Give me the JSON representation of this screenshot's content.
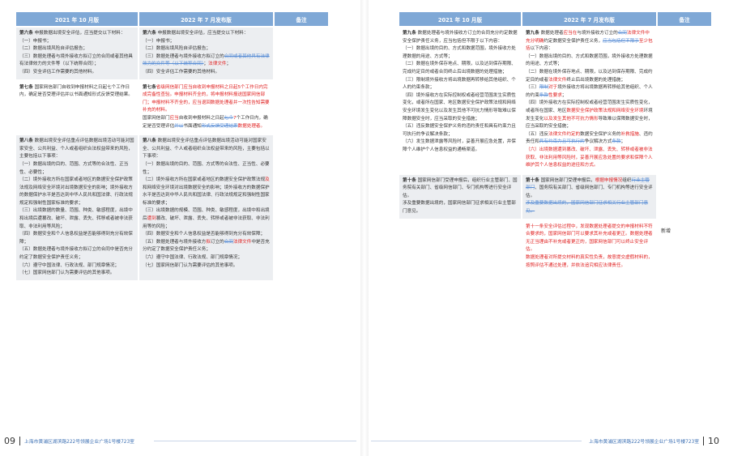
{
  "header": {
    "col1": "2021 年 10 月版",
    "col2": "2022 年 7 月发布版",
    "col3": "备注"
  },
  "left": {
    "rows": [
      {
        "c1": [
          {
            "t": "第六条",
            "s": "b"
          },
          {
            "t": " 申报数据出境安全评估，应当提交以下材料：\n（一）申报书；\n（二）数据出境风险自评估报告；\n（三）数据处理者与境外接收方拟订立的合同或者其他具有法律效力的文件等（以下统称合同）；\n（四）安全评估工作需要的其他材料。"
          }
        ],
        "c2": [
          {
            "t": "第六条",
            "s": "b"
          },
          {
            "t": " 申报数据出境安全评估，应当提交以下材料：\n（一）申报书；\n（二）数据出境风险自评估报告；\n（三）数据处理者与境外接收方拟订立的"
          },
          {
            "t": "合同或者其他具有法律效力的文件等（以下统称合同）",
            "s": "del"
          },
          {
            "t": "；"
          },
          {
            "t": "法律文件",
            "s": "red"
          },
          {
            "t": "；\n（四）安全评估工作需要的其他材料。"
          }
        ],
        "c3": "",
        "white": false
      },
      {
        "c1": [
          {
            "t": "第七条",
            "s": "b"
          },
          {
            "t": " 国家网信部门自收到申报材料之日起七个工作日内，确定是否受理评估并以书面通知形式反馈受理结果。"
          }
        ],
        "c2": [
          {
            "t": "第七条",
            "s": "b"
          },
          {
            "t": "省级网信部门应当自收到申报材料之日起5个工作日内完成完备性查验。申报材料齐全的，将申报材料报送国家网信部门；申报材料不齐全的，应当退回数据处理者并一次性告知需要补充的材料。",
            "s": "red"
          },
          {
            "t": "\n国家网信部门"
          },
          {
            "t": "应当",
            "s": "red"
          },
          {
            "t": "自收到申报材料之日起"
          },
          {
            "t": "七个",
            "s": "del"
          },
          {
            "t": "7",
            "s": "red"
          },
          {
            "t": "个工作日内，确定是否受理评估"
          },
          {
            "t": "并以",
            "s": "del"
          },
          {
            "t": "书面通知"
          },
          {
            "t": "形式反馈受理结果",
            "s": "del"
          },
          {
            "t": "数据处理者。",
            "s": "red"
          }
        ],
        "c3": "",
        "white": true
      },
      {
        "c1": [
          {
            "t": "第八条",
            "s": "b"
          },
          {
            "t": " 数据出境安全评估重点评估数据出境活动可能对国家安全、公共利益、个人或者组织合法权益带来的风险，主要包括以下事项：\n（一）数据出境的目的、范围、方式等的合法性、正当性、必要性；\n（二）境外接收方所在国家或者地区的数据安全保护政策法规及网络安全环境对出境数据安全的影响；境外接收方的数据保护水平是否达到中华人民共和国法律、行政法规规定和强制性国家标准的要求；\n（三）出境数据的数量、范围、种类、敏感程度，出境中和出境后遭篡改、破坏、泄露、丢失、转移或者被非法获取、非法利用等风险；\n（四）数据安全和个人信息权益是否能够得到充分有效保障；\n（五）数据处理者与境外接收方拟订立的合同中是否充分约定了数据安全保护责任义务；\n（六）遵守中国法律、行政法规、部门规章情况；\n（七）国家网信部门认为需要评估的其他事项。"
          }
        ],
        "c2": [
          {
            "t": "第八条",
            "s": "b"
          },
          {
            "t": " 数据出境安全评估重点评估数据出境活动可能对国家安全、公共利益、个人或者组织合法权益带来的风险，主要包括以下事项：\n（一）数据出境的目的、范围、方式等的合法性、正当性、必要性；\n（二）境外接收方所在国家或者地区的数据安全保护政策法规"
          },
          {
            "t": "及",
            "s": "red"
          },
          {
            "t": "和网络安全环境对出境数据安全的影响；境外接收方的数据保护水平是否达到中华人民共和国法律、行政法规规定和强制性国家标准的要求；\n（三）出境数据的规模、范围、种类、敏感程度，出境中和出境后"
          },
          {
            "t": "遭到",
            "s": "red"
          },
          {
            "t": "篡改、破坏、泄露、丢失、转移或者被非法获取、非法利用等的风险；\n（四）数据安全和个人信息权益是否能够得到充分有效保障；\n（五）数据处理者与境外接收方"
          },
          {
            "t": "拟",
            "s": "red"
          },
          {
            "t": "订立的"
          },
          {
            "t": "合同",
            "s": "del"
          },
          {
            "t": "法律文件",
            "s": "red"
          },
          {
            "t": "中是否充分约定了数据安全保护责任义务；\n（六）遵守中国法律、行政法规、部门规章情况；\n（七）国家网信部门认为需要评估的其他事项。"
          }
        ],
        "c3": "",
        "white": false
      }
    ]
  },
  "right": {
    "rows": [
      {
        "c1": [
          {
            "t": "第九条",
            "s": "b"
          },
          {
            "t": " 数据处理者与境外接收方订立的合同充分约定数据安全保护责任义务，应当包括但不限于以下内容：\n（一）数据出境的目的、方式和数据范围，境外接收方处理数据的用途、方式等；\n（二）数据在境外保存地点、期限，以及达到保存期限、完成约定目的或者合同终止后出境数据的处理措施；\n（三）限制境外接收方将出境数据再转移给其他组织、个人的约束条款；\n（四）境外接收方在实际控制权或者经营范围发生实质性变化，或者所在国家、地区数据安全保护政策法规和网络安全环境发生变化以及发生其他不可抗力情形导致难以保障数据安全时，应当采取的安全措施；\n（五）违反数据安全保护义务的违约责任和具有约束力且可执行的争议解决条款；\n（六）发生数据泄露等风险时，妥善开展应急处置，并保障个人维护个人信息权益的通畅渠道。"
          }
        ],
        "c2": [
          {
            "t": "第九条",
            "s": "b"
          },
          {
            "t": " 数据处理者"
          },
          {
            "t": "应当在",
            "s": "red"
          },
          {
            "t": "与境外接收方订立的"
          },
          {
            "t": "合同",
            "s": "del"
          },
          {
            "t": "法律文件中充分明确",
            "s": "red"
          },
          {
            "t": "约定数据安全保护责任义务，"
          },
          {
            "t": "应当包括但不限于",
            "s": "del"
          },
          {
            "t": "至少包括",
            "s": "red"
          },
          {
            "t": "以下内容：\n（一）数据出境的目的、方式和数据范围，境外接收方处理数据的用途、方式等；\n（二）数据在境外保存地点、期限，以及达到保存期限、完成约定目的或者"
          },
          {
            "t": "法律文件",
            "s": "red"
          },
          {
            "t": "终止后出境数据的处理措施；\n（三）"
          },
          {
            "t": "限制",
            "s": "del"
          },
          {
            "t": "对于",
            "s": "red"
          },
          {
            "t": "境外接收方将出境数据再转移给其他组织、个人的约束"
          },
          {
            "t": "条款",
            "s": "del"
          },
          {
            "t": "性要求",
            "s": "red"
          },
          {
            "t": "；\n（四）境外接收方在实际控制权或者经营范围发生实质性变化，或者所在国家、地区"
          },
          {
            "t": "数据安全保护政策法规和网络安全环境",
            "s": "red"
          },
          {
            "t": "环境发生变化"
          },
          {
            "t": "以及发生其他不可抗力情形",
            "s": "red"
          },
          {
            "t": "导致难以保障数据安全时，应当采取的安全措施；\n（五）违反"
          },
          {
            "t": "法律文件约定的",
            "s": "red"
          },
          {
            "t": "数据安全保护义务的"
          },
          {
            "t": "补救措施",
            "s": "red"
          },
          {
            "t": "、违约责任和"
          },
          {
            "t": "具有约束力且可执行的",
            "s": "del"
          },
          {
            "t": "争议解决方式"
          },
          {
            "t": "条款",
            "s": "del"
          },
          {
            "t": "；\n"
          },
          {
            "t": "（六）出境数据遭到篡改、破坏、泄露、丢失、转移或者被非法获取、非法利用等风险时，妥善开展应急处置的要求和保障个人维护其个人信息权益的途径和方式。",
            "s": "red"
          }
        ],
        "c3": "",
        "white": true
      },
      {
        "c1": [
          {
            "t": "第十条",
            "s": "b"
          },
          {
            "t": " 国家网信部门受理申报后，组织行业主管部门、国务院有关部门、省级网信部门、专门机构等进行安全评估。\n涉及重要数据出境的，国家网信部门征求相关行业主管部门意见。"
          }
        ],
        "c2": [
          {
            "t": "第十条",
            "s": "b"
          },
          {
            "t": " 国家网信部门受理申报后，"
          },
          {
            "t": "根据申报情况",
            "s": "red"
          },
          {
            "t": "组织"
          },
          {
            "t": "行业主管部门",
            "s": "del"
          },
          {
            "t": "、国务院有关部门、省级网信部门、专门机构等进行安全评估。\n"
          },
          {
            "t": "涉及重要数据出境的，国家网信部门征求相关行业主管部门意见。",
            "s": "del"
          }
        ],
        "c3": "",
        "white": false
      },
      {
        "c1": [],
        "c2": [
          {
            "t": "第十一条安全评估过程中，发现数据处理者提交的申报材料不符合要求的，国家网信部门可以要求其补充或者更正。数据处理者无正当理由不补充或者更正的，国家网信部门可以终止安全评估。\n数据处理者对所提交材料的真实性负责，故意提交虚假材料的，按照评估不通过处理，并依法追究相应法律责任。",
            "s": "red"
          }
        ],
        "c3": "新增",
        "white": true
      }
    ]
  },
  "footer": {
    "left_page": "09",
    "right_page": "10",
    "address": "上海市黄浦区湖滨路222号领展企业广场1号楼723室"
  }
}
